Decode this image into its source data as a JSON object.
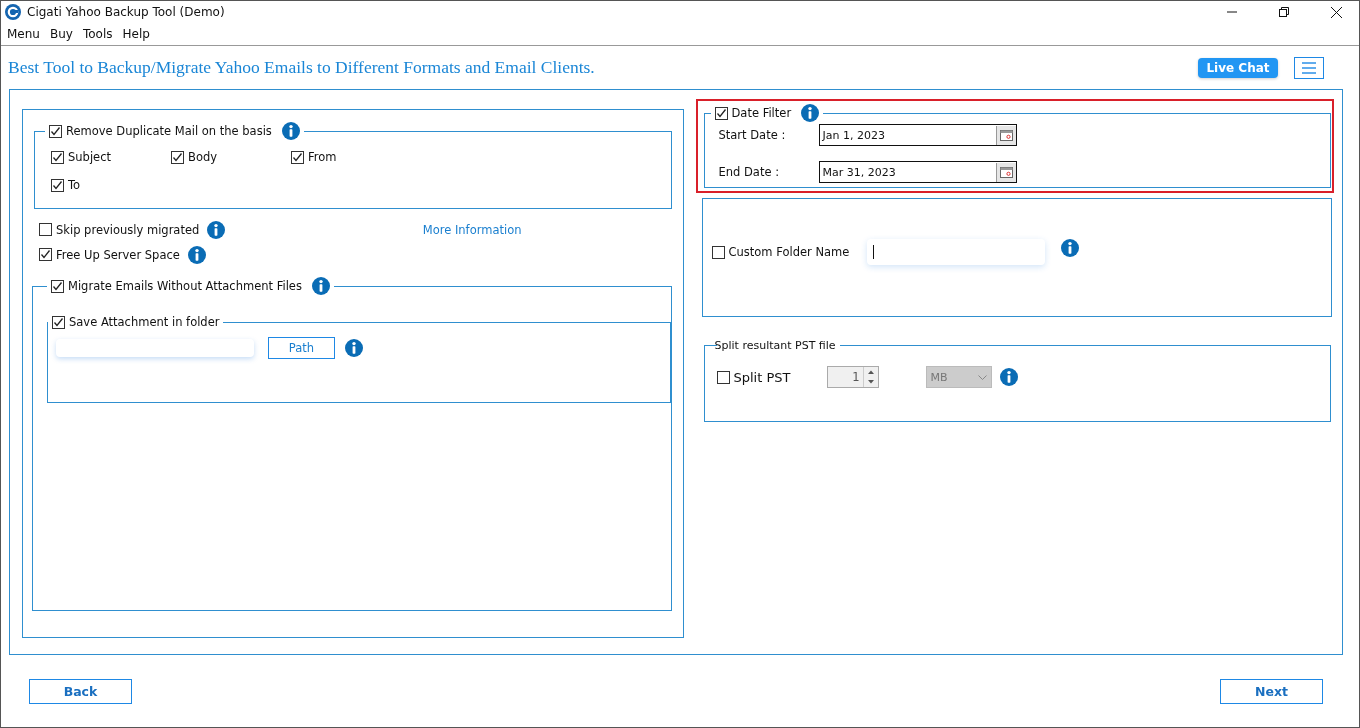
{
  "window": {
    "title": "Cigati Yahoo Backup Tool (Demo)"
  },
  "menu": [
    "Menu",
    "Buy",
    "Tools",
    "Help"
  ],
  "tagline": "Best Tool to Backup/Migrate Yahoo Emails to Different Formats and Email Clients.",
  "live_chat": "Live Chat",
  "duplicate_filter": {
    "label": "Remove Duplicate Mail on the basis",
    "checked": true,
    "fields": [
      {
        "label": "Subject",
        "checked": true
      },
      {
        "label": "Body",
        "checked": true
      },
      {
        "label": "From",
        "checked": true
      },
      {
        "label": "To",
        "checked": true
      }
    ]
  },
  "options": [
    {
      "label": "Skip previously migrated",
      "checked": false
    },
    {
      "label": "Free Up Server Space",
      "checked": true
    }
  ],
  "more_info_link": "More Information",
  "attachments": {
    "label": "Migrate Emails Without Attachment Files",
    "checked": true,
    "save_in_folder": {
      "label": "Save Attachment in folder",
      "checked": true,
      "path_button": "Path"
    }
  },
  "date_filter": {
    "label": "Date Filter",
    "checked": true,
    "highlighted": true,
    "start": {
      "label": "Start Date :",
      "value": "Jan 1, 2023"
    },
    "end": {
      "label": "End Date :",
      "value": "Mar 31, 2023"
    }
  },
  "custom_folder": {
    "label": "Custom Folder Name",
    "checked": false
  },
  "split": {
    "title": "Split resultant PST file",
    "label": "Split PST",
    "checked": false,
    "size": "1",
    "unit": "MB",
    "disabled": true
  },
  "buttons": {
    "back": "Back",
    "next": "Next"
  }
}
